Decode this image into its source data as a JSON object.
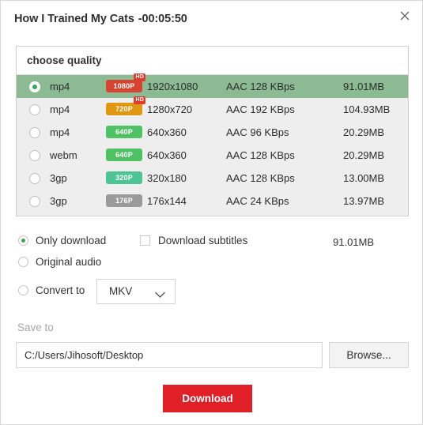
{
  "window": {
    "title": "How I Trained My Cats",
    "duration": "-00:05:50",
    "close_icon": "close-icon"
  },
  "quality": {
    "header": "choose quality",
    "rows": [
      {
        "format": "mp4",
        "badge": "1080P",
        "badge_color": "#d94331",
        "hd": "HD",
        "resolution": "1920x1080",
        "audio": "AAC 128 KBps",
        "size": "91.01MB",
        "selected": true
      },
      {
        "format": "mp4",
        "badge": "720P",
        "badge_color": "#e09712",
        "hd": "HD",
        "resolution": "1280x720",
        "audio": "AAC 192 KBps",
        "size": "104.93MB",
        "selected": false
      },
      {
        "format": "mp4",
        "badge": "640P",
        "badge_color": "#4fc263",
        "hd": "",
        "resolution": "640x360",
        "audio": "AAC 96 KBps",
        "size": "20.29MB",
        "selected": false
      },
      {
        "format": "webm",
        "badge": "640P",
        "badge_color": "#4fc263",
        "hd": "",
        "resolution": "640x360",
        "audio": "AAC 128 KBps",
        "size": "20.29MB",
        "selected": false
      },
      {
        "format": "3gp",
        "badge": "320P",
        "badge_color": "#4cc494",
        "hd": "",
        "resolution": "320x180",
        "audio": "AAC 128 KBps",
        "size": "13.00MB",
        "selected": false
      },
      {
        "format": "3gp",
        "badge": "176P",
        "badge_color": "#9a9a9a",
        "hd": "",
        "resolution": "176x144",
        "audio": "AAC 24 KBps",
        "size": "13.97MB",
        "selected": false
      }
    ]
  },
  "options": {
    "only_download": "Only download",
    "only_download_selected": true,
    "download_subtitles": "Download subtitles",
    "download_subtitles_checked": false,
    "original_audio": "Original audio",
    "original_audio_selected": false,
    "convert_to": "Convert to",
    "convert_to_selected": false,
    "convert_format": "MKV",
    "convert_format_options": [
      "MKV"
    ],
    "total_size": "91.01MB"
  },
  "save": {
    "label": "Save to",
    "path": "C:/Users/Jihosoft/Desktop",
    "browse_label": "Browse..."
  },
  "actions": {
    "download_label": "Download",
    "download_color": "#e01f26"
  }
}
